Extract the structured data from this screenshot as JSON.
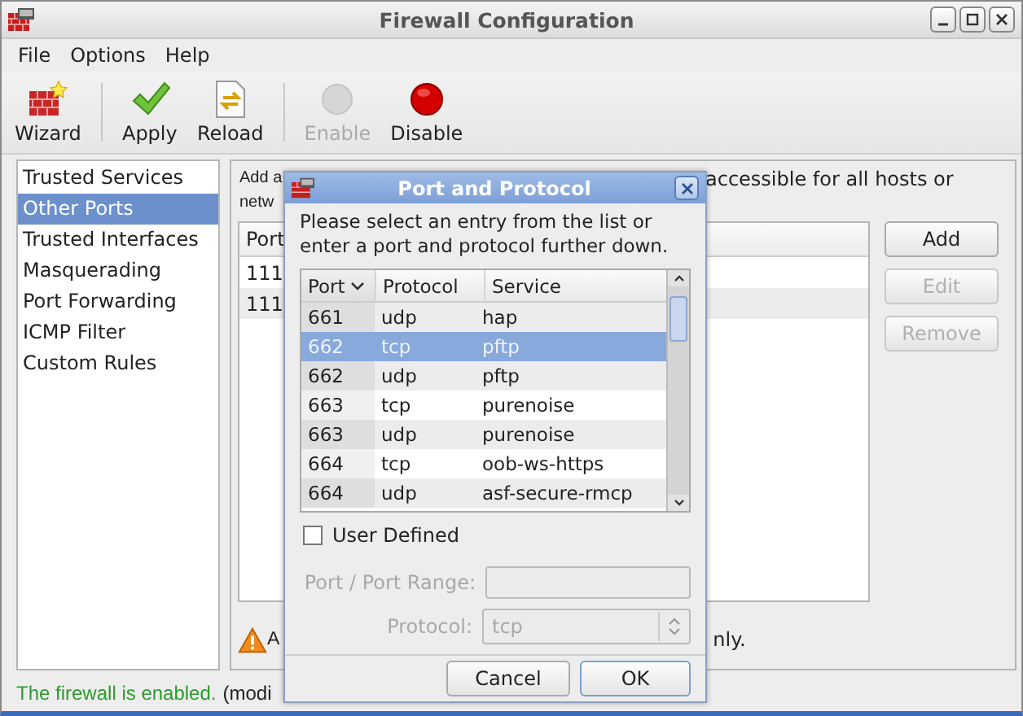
{
  "window": {
    "title": "Firewall Configuration"
  },
  "menu": [
    "File",
    "Options",
    "Help"
  ],
  "toolbar": {
    "groups": [
      {
        "buttons": [
          {
            "label": "Wizard",
            "kind": "wizard",
            "disabled": false
          }
        ]
      },
      {
        "buttons": [
          {
            "label": "Apply",
            "kind": "apply",
            "disabled": false
          },
          {
            "label": "Reload",
            "kind": "reload",
            "disabled": false
          }
        ]
      },
      {
        "buttons": [
          {
            "label": "Enable",
            "kind": "enable",
            "disabled": true
          },
          {
            "label": "Disable",
            "kind": "disable",
            "disabled": false
          }
        ]
      }
    ]
  },
  "sidebar": {
    "items": [
      {
        "label": "Trusted Services",
        "selected": false
      },
      {
        "label": "Other Ports",
        "selected": true
      },
      {
        "label": "Trusted Interfaces",
        "selected": false
      },
      {
        "label": "Masquerading",
        "selected": false
      },
      {
        "label": "Port Forwarding",
        "selected": false
      },
      {
        "label": "ICMP Filter",
        "selected": false
      },
      {
        "label": "Custom Rules",
        "selected": false
      }
    ]
  },
  "main": {
    "description_left": [
      "Add a",
      "netw"
    ],
    "description_right": "accessible for all hosts or",
    "table": {
      "columns": [
        "Port"
      ],
      "rows": [
        "111",
        "111"
      ]
    },
    "buttons": [
      {
        "label": "Add",
        "disabled": false
      },
      {
        "label": "Edit",
        "disabled": true
      },
      {
        "label": "Remove",
        "disabled": true
      }
    ],
    "notice_left": "A",
    "notice_right": "nly."
  },
  "status_bar": {
    "message": "The firewall is enabled.",
    "note": "(modi"
  },
  "dialog": {
    "title": "Port and Protocol",
    "instructions": "Please select an entry from the list or enter a port and protocol further down.",
    "table": {
      "columns": [
        {
          "label": "Port",
          "sorted": true
        },
        {
          "label": "Protocol",
          "sorted": false
        },
        {
          "label": "Service",
          "sorted": false
        }
      ],
      "rows": [
        {
          "port": "661",
          "protocol": "udp",
          "service": "hap",
          "selected": false
        },
        {
          "port": "662",
          "protocol": "tcp",
          "service": "pftp",
          "selected": true
        },
        {
          "port": "662",
          "protocol": "udp",
          "service": "pftp",
          "selected": false
        },
        {
          "port": "663",
          "protocol": "tcp",
          "service": "purenoise",
          "selected": false
        },
        {
          "port": "663",
          "protocol": "udp",
          "service": "purenoise",
          "selected": false
        },
        {
          "port": "664",
          "protocol": "tcp",
          "service": "oob-ws-https",
          "selected": false
        },
        {
          "port": "664",
          "protocol": "udp",
          "service": "asf-secure-rmcp",
          "selected": false
        }
      ]
    },
    "user_defined": {
      "label": "User Defined",
      "checked": false
    },
    "port_field": {
      "label": "Port / Port Range:",
      "disabled": true
    },
    "protocol_field": {
      "label": "Protocol:",
      "value": "tcp",
      "disabled": true
    },
    "buttons": [
      {
        "label": "Cancel",
        "default": false
      },
      {
        "label": "OK",
        "default": true
      }
    ]
  }
}
